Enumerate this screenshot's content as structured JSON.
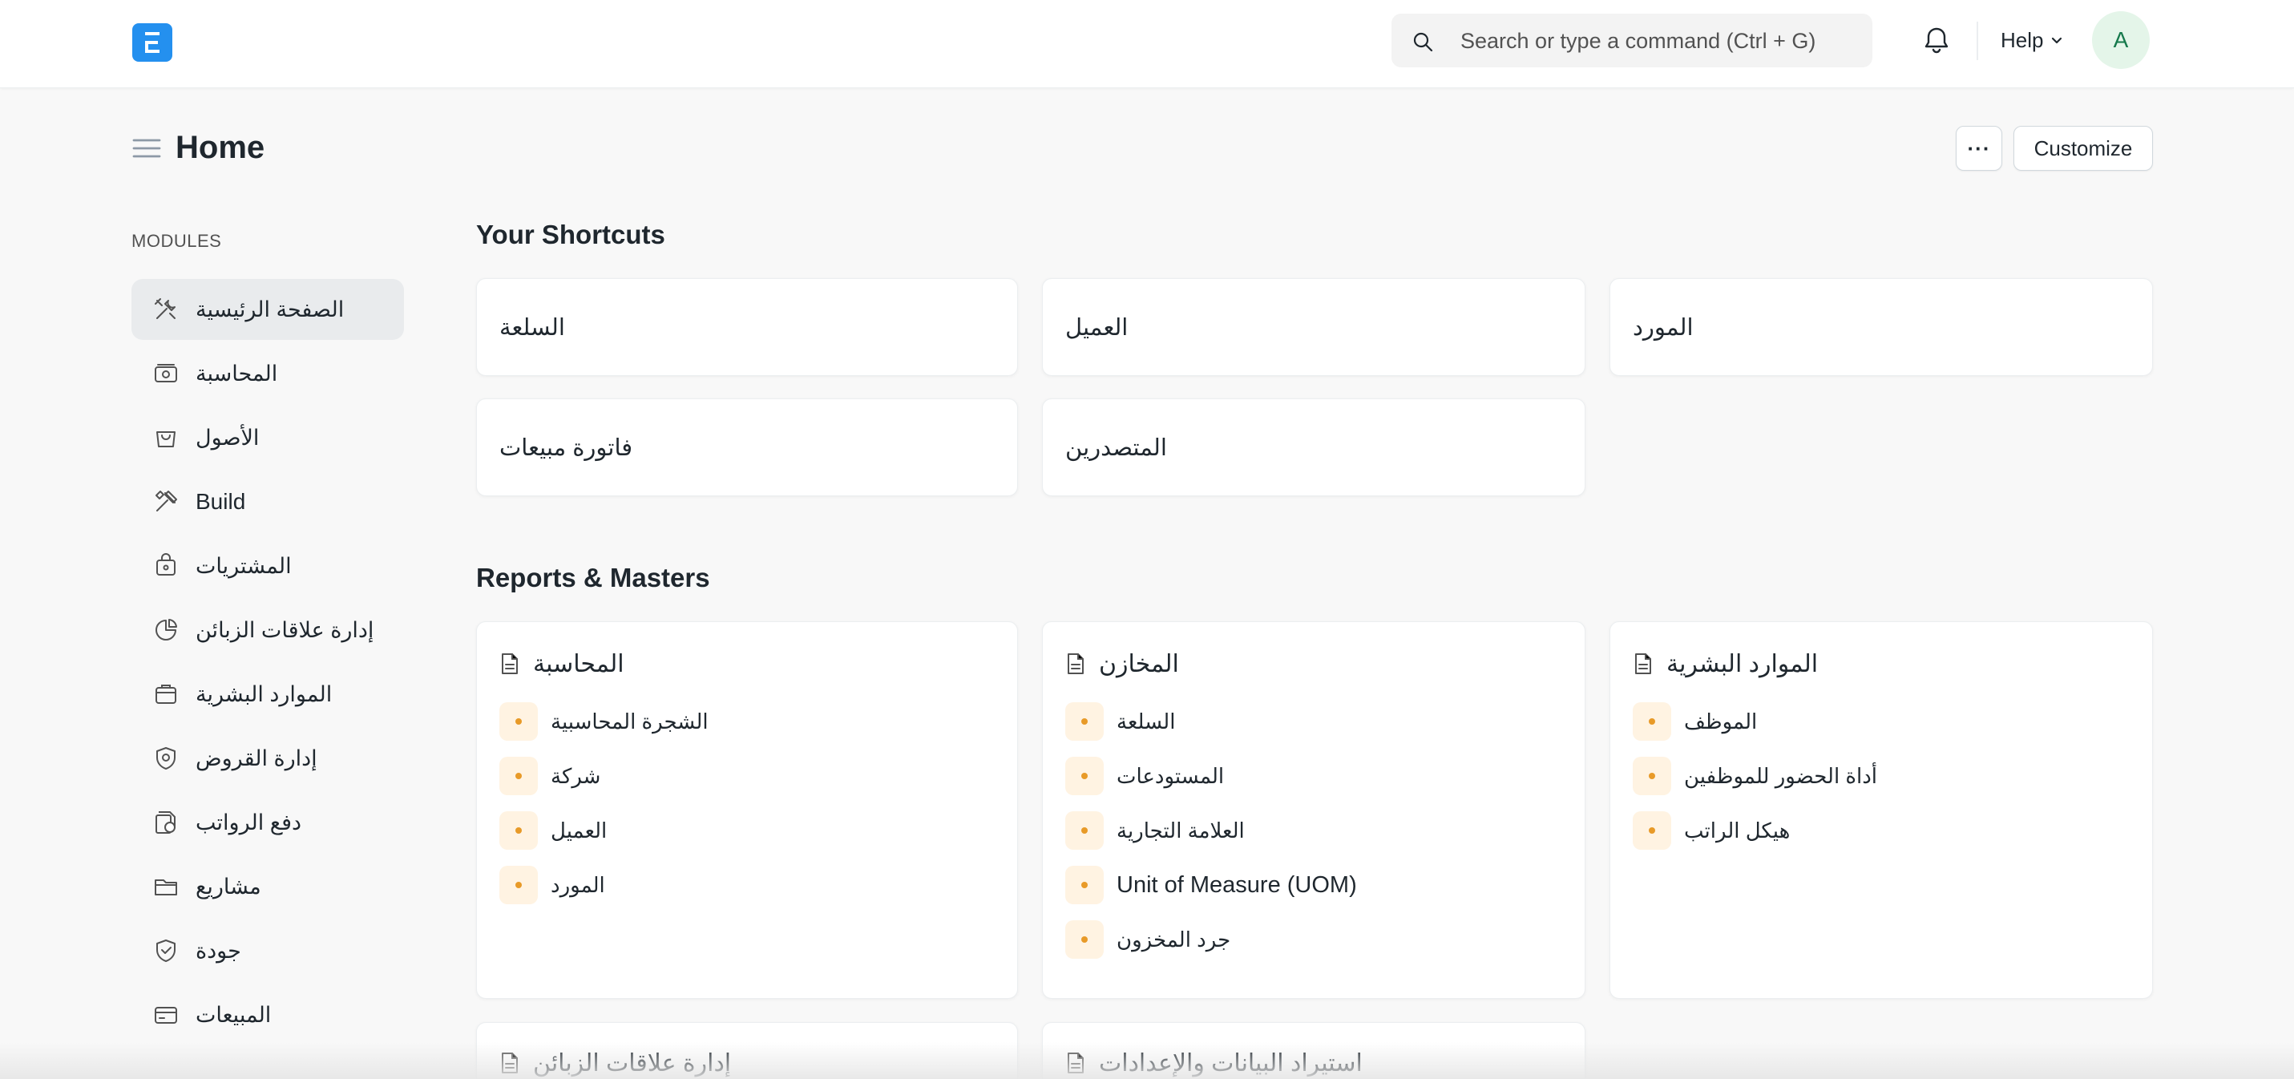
{
  "navbar": {
    "logo_letter": "E",
    "search_placeholder": "Search or type a command (Ctrl + G)",
    "help_label": "Help",
    "avatar_letter": "A"
  },
  "page": {
    "title": "Home",
    "more_label": "···",
    "customize_label": "Customize"
  },
  "sidebar": {
    "section_label": "MODULES",
    "items": [
      {
        "label": "الصفحة الرئيسية",
        "icon": "tools-icon",
        "active": true
      },
      {
        "label": "المحاسبة",
        "icon": "accounting-icon"
      },
      {
        "label": "الأصول",
        "icon": "assets-icon"
      },
      {
        "label": "Build",
        "icon": "build-icon"
      },
      {
        "label": "المشتريات",
        "icon": "buying-icon"
      },
      {
        "label": "إدارة علاقات الزبائن",
        "icon": "crm-icon"
      },
      {
        "label": "الموارد البشرية",
        "icon": "hr-icon"
      },
      {
        "label": "إدارة القروض",
        "icon": "loan-icon"
      },
      {
        "label": "دفع الرواتب",
        "icon": "payroll-icon"
      },
      {
        "label": "مشاريع",
        "icon": "projects-icon"
      },
      {
        "label": "جودة",
        "icon": "quality-icon"
      },
      {
        "label": "المبيعات",
        "icon": "selling-icon"
      }
    ]
  },
  "shortcuts": {
    "title": "Your Shortcuts",
    "items": [
      "السلعة",
      "العميل",
      "المورد",
      "فاتورة مبيعات",
      "المتصدرين"
    ]
  },
  "reports": {
    "title": "Reports & Masters",
    "cards": [
      {
        "title": "المحاسبة",
        "links": [
          "الشجرة المحاسبية",
          "شركة",
          "العميل",
          "المورد"
        ]
      },
      {
        "title": "المخازن",
        "links": [
          "السلعة",
          "المستودعات",
          "العلامة التجارية",
          "Unit of Measure (UOM)",
          "جرد المخزون"
        ]
      },
      {
        "title": "الموارد البشرية",
        "links": [
          "الموظف",
          "أداة الحضور للموظفين",
          "هيكل الراتب"
        ]
      },
      {
        "title": "إدارة علاقات الزبائن",
        "links": []
      },
      {
        "title": "استيراد البيانات والإعدادات",
        "links": []
      }
    ]
  },
  "colors": {
    "brand": "#2490ef",
    "link_dot": "#e89a28",
    "link_dot_bg": "#fff3e2",
    "avatar_bg": "#e4f5e9",
    "avatar_fg": "#16794c"
  }
}
